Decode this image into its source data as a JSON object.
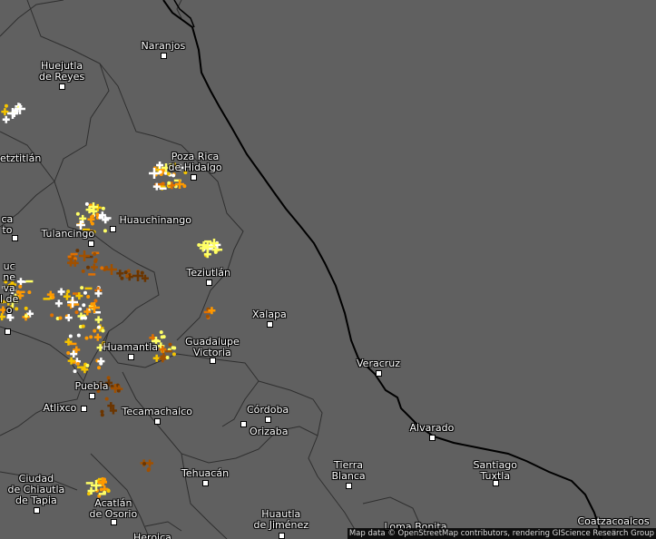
{
  "map": {
    "attribution": "Map data © OpenStreetMap contributors, rendering GIScience Research Group",
    "colors": {
      "background": "#606060",
      "coast": "#000000",
      "borders": "#2f2f2f",
      "label": "#ffffff"
    },
    "cities": [
      {
        "id": "naranjos",
        "label": "Naranjos"
      },
      {
        "id": "huejutla",
        "label": "Huejutla de Reyes"
      },
      {
        "id": "tzitlan",
        "label": "etztitlán"
      },
      {
        "id": "poza-rica",
        "label": "Poza Rica de Hidalgo"
      },
      {
        "id": "huauchinango",
        "label": "Huauchinango"
      },
      {
        "id": "tulancingo",
        "label": "Tulancingo"
      },
      {
        "id": "teziutlan",
        "label": "Teziutlán"
      },
      {
        "id": "xalapa",
        "label": "Xalapa"
      },
      {
        "id": "guadalupe-victoria",
        "label": "Guadalupe Victoria"
      },
      {
        "id": "huamantla",
        "label": "Huamantla"
      },
      {
        "id": "veracruz",
        "label": "Veracruz"
      },
      {
        "id": "puebla",
        "label": "Puebla"
      },
      {
        "id": "atlixco",
        "label": "Atlixco"
      },
      {
        "id": "tecamachalco",
        "label": "Tecamachalco"
      },
      {
        "id": "cordoba",
        "label": "Córdoba"
      },
      {
        "id": "orizaba",
        "label": "Orizaba"
      },
      {
        "id": "alvarado",
        "label": "Alvarado"
      },
      {
        "id": "tehuacan",
        "label": "Tehuacán"
      },
      {
        "id": "tierra-blanca",
        "label": "Tierra Blanca"
      },
      {
        "id": "santiago-tuxtla",
        "label": "Santiago Tuxtla"
      },
      {
        "id": "chiautla",
        "label": "Ciudad de Chiautla de Tapia"
      },
      {
        "id": "acatlan",
        "label": "Acatlán de Osorio"
      },
      {
        "id": "huautla",
        "label": "Huautla de Jiménez"
      },
      {
        "id": "loma-bonita",
        "label": "Loma Bonita"
      },
      {
        "id": "coatzacoalcos",
        "label": "Coatzacoalcos"
      },
      {
        "id": "heroica",
        "label": "Heroica"
      },
      {
        "id": "left-ca",
        "label": "ca to"
      },
      {
        "id": "left-uc",
        "label": "uc ne va l de o"
      }
    ]
  }
}
